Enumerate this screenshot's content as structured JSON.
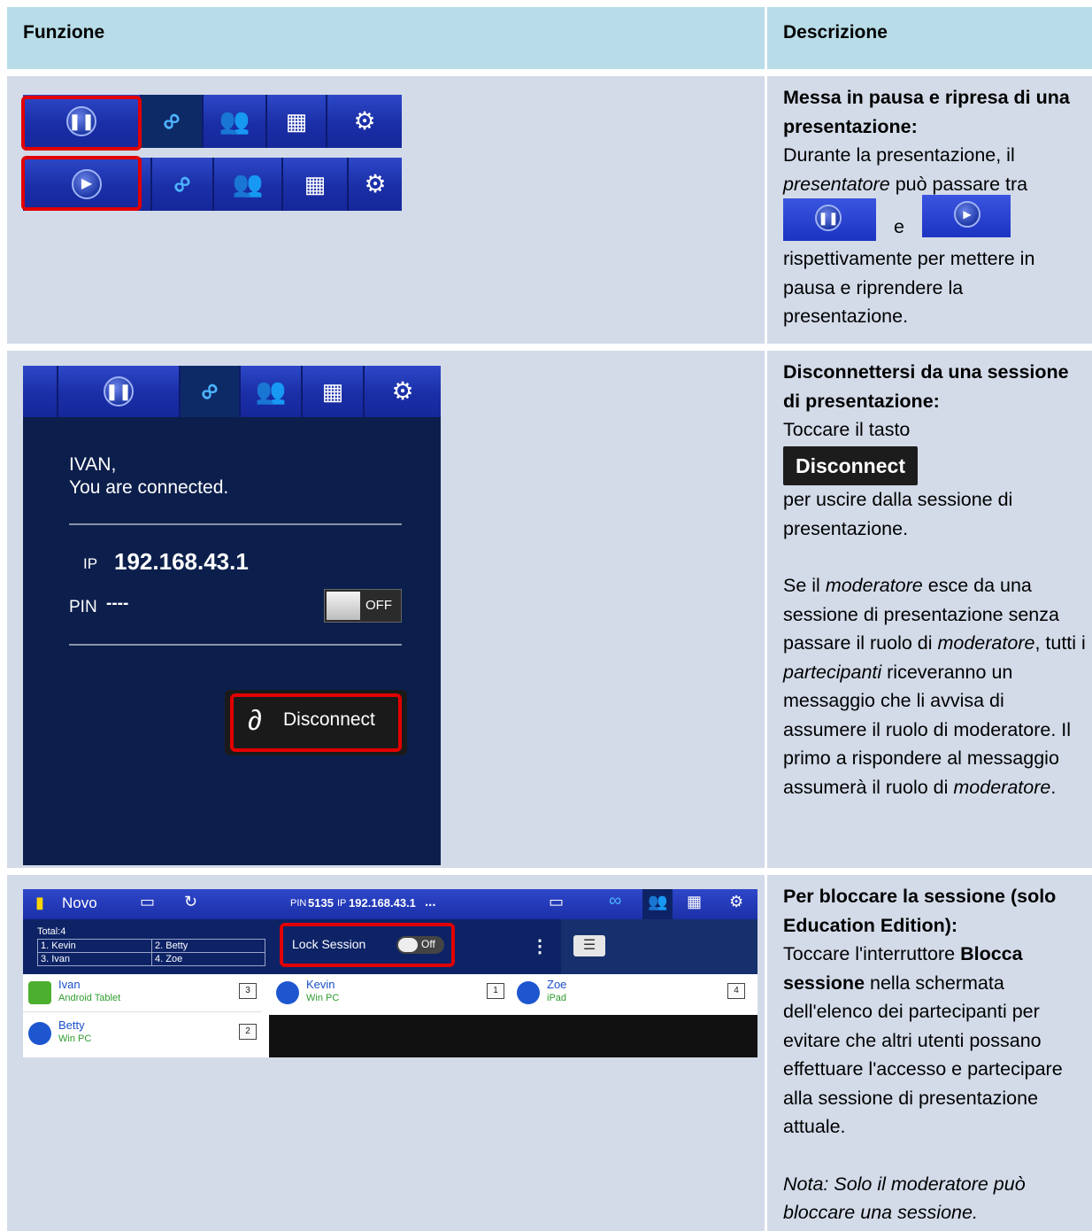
{
  "header": {
    "col1": "Funzione",
    "col2": "Descrizione"
  },
  "row1": {
    "title": "Messa in pausa e ripresa di una presentazione:",
    "p1_a": "Durante la presentazione, il ",
    "p1_em": "presentatore",
    "p1_b": " può passare tra",
    "p1_and": "e",
    "p1_c": "rispettivamente per mettere in pausa e riprendere la presentazione."
  },
  "row2": {
    "title": "Disconnettersi da una sessione di presentazione:",
    "p1_a": "Toccare il tasto",
    "p1_btn": "Disconnect",
    "p1_b": "per uscire dalla sessione di presentazione.",
    "p2_a": "Se il ",
    "p2_em1": "moderatore",
    "p2_b": " esce da una sessione di presentazione senza passare il ruolo di ",
    "p2_em2": "moderatore",
    "p2_c": ", tutti i ",
    "p2_em3": "partecipanti",
    "p2_d": " riceveranno un messaggio che li avvisa di assumere il ruolo di moderatore. Il primo a rispondere al messaggio assumerà il ruolo di ",
    "p2_em4": "moderatore",
    "p2_e": ".",
    "panel": {
      "user_line": "IVAN,",
      "status": "You are connected.",
      "ip_label": "IP",
      "ip": "192.168.43.1",
      "pin_label": "PIN",
      "pin_value": "----",
      "toggle_state": "OFF",
      "disconnect_label": "Disconnect"
    }
  },
  "row3": {
    "title": "Per bloccare la sessione (solo Education Edition):",
    "p1_a": "Toccare l'interruttore ",
    "p1_strong": "Blocca sessione",
    "p1_b": " nella schermata dell'elenco dei partecipanti per evitare che altri utenti possano effettuare l'accesso e partecipare alla sessione di presentazione attuale.",
    "note": "Nota: Solo il moderatore può bloccare una sessione.",
    "novo": {
      "app_name": "Novo",
      "pin_label": "PIN",
      "pin": "5135",
      "ip_label": "IP",
      "ip": "192.168.43.1",
      "more": "...",
      "total": "Total:4",
      "p1": "1. Kevin",
      "p2": "2. Betty",
      "p3": "3. Ivan",
      "p4": "4. Zoe",
      "lock_label": "Lock Session",
      "lock_state": "Off",
      "users": [
        {
          "name": "Ivan",
          "device": "Android Tablet",
          "slot": "3"
        },
        {
          "name": "Kevin",
          "device": "Win PC",
          "slot": "1"
        },
        {
          "name": "Zoe",
          "device": "iPad",
          "slot": "4"
        },
        {
          "name": "Betty",
          "device": "Win PC",
          "slot": "2"
        }
      ]
    }
  },
  "colors": {
    "header_bg": "#b8dde8",
    "cell_bg": "#d3dbe9",
    "highlight": "#e10000",
    "toolbar": "#1f37b8"
  }
}
